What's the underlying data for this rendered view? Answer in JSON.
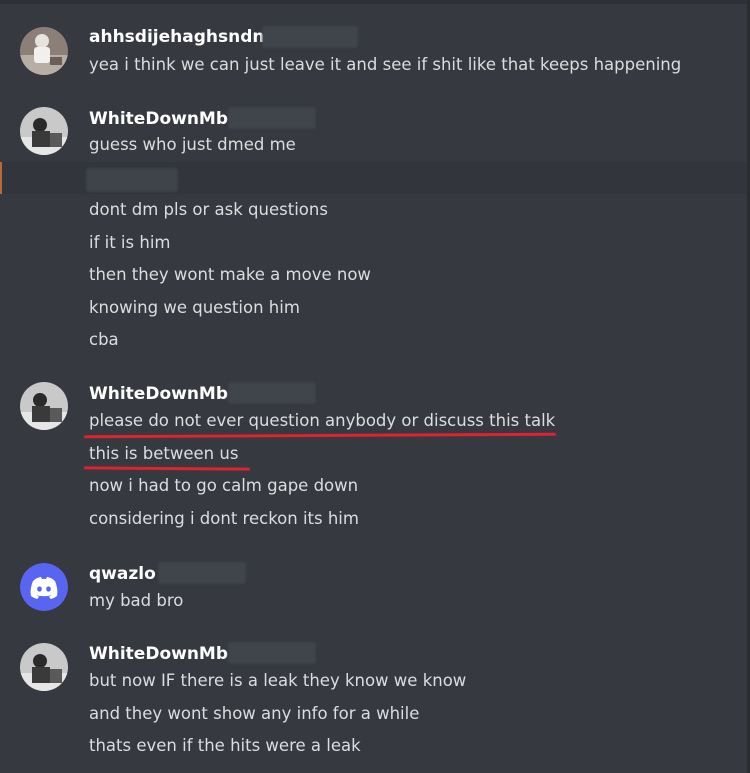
{
  "messages": [
    {
      "author": "ahhsdijehaghsndnd",
      "avatar_icon": "user-photo-avatar-icon",
      "lines": [
        "yea i think we can just leave it and see if shit like that keeps happening"
      ]
    },
    {
      "author": "WhiteDownMb",
      "avatar_icon": "user-photo-avatar-icon",
      "lines": [
        "guess who just dmed me",
        "",
        "dont dm pls or ask questions",
        "if it is him",
        "then they wont make a move now",
        "knowing we question him",
        "cba"
      ]
    },
    {
      "author": "WhiteDownMb",
      "avatar_icon": "user-photo-avatar-icon",
      "lines": [
        "please do not ever question anybody or discuss this talk",
        "this is between us",
        "now i had to go calm gape down",
        "considering i dont reckon its him"
      ]
    },
    {
      "author": "qwazlo",
      "avatar_icon": "discord-default-avatar-icon",
      "lines": [
        "my bad bro"
      ]
    },
    {
      "author": "WhiteDownMb",
      "avatar_icon": "user-photo-avatar-icon",
      "lines": [
        "but now IF there is a leak they know we know",
        "and they wont show any info for a while",
        "thats even if the hits were a leak"
      ]
    }
  ],
  "colors": {
    "background": "#36393f",
    "text": "#dcddde",
    "author": "#ffffff",
    "discord_blurple": "#5865f2",
    "annotation_red": "#e0212f"
  }
}
